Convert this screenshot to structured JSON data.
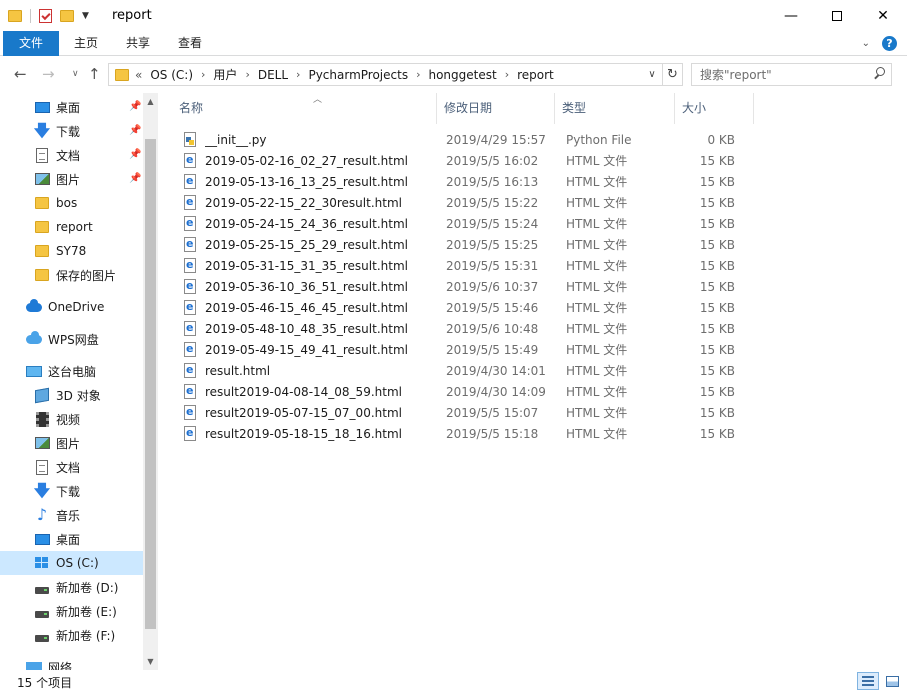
{
  "window": {
    "title": "report",
    "minimize_glyph": "—",
    "close_glyph": "✕"
  },
  "ribbon": {
    "tabs": [
      "文件",
      "主页",
      "共享",
      "查看"
    ]
  },
  "address": {
    "lead": "«",
    "crumbs": [
      "OS (C:)",
      "用户",
      "DELL",
      "PycharmProjects",
      "honggetest",
      "report"
    ],
    "search_placeholder": "搜索\"report\""
  },
  "nav": {
    "items": [
      {
        "label": "桌面",
        "icon": "desktop-icon",
        "pinned": true
      },
      {
        "label": "下载",
        "icon": "download-icon",
        "pinned": true
      },
      {
        "label": "文档",
        "icon": "document-icon",
        "pinned": true
      },
      {
        "label": "图片",
        "icon": "pictures-icon",
        "pinned": true
      },
      {
        "label": "bos",
        "icon": "folder-icon",
        "pinned": false
      },
      {
        "label": "report",
        "icon": "folder-icon",
        "pinned": false
      },
      {
        "label": "SY78",
        "icon": "folder-icon",
        "pinned": false
      },
      {
        "label": "保存的图片",
        "icon": "folder-icon",
        "pinned": false
      },
      {
        "label": "OneDrive",
        "icon": "onedrive-icon",
        "pinned": false
      },
      {
        "label": "WPS网盘",
        "icon": "wps-cloud-icon",
        "pinned": false
      },
      {
        "label": "这台电脑",
        "icon": "this-pc-icon",
        "pinned": false
      },
      {
        "label": "3D 对象",
        "icon": "3d-objects-icon",
        "pinned": false
      },
      {
        "label": "视频",
        "icon": "video-icon",
        "pinned": false
      },
      {
        "label": "图片",
        "icon": "pictures-icon",
        "pinned": false
      },
      {
        "label": "文档",
        "icon": "document-icon",
        "pinned": false
      },
      {
        "label": "下载",
        "icon": "download-icon",
        "pinned": false
      },
      {
        "label": "音乐",
        "icon": "music-icon",
        "pinned": false
      },
      {
        "label": "桌面",
        "icon": "desktop-icon",
        "pinned": false
      },
      {
        "label": "OS (C:)",
        "icon": "os-drive-icon",
        "pinned": false,
        "selected": true
      },
      {
        "label": "新加卷 (D:)",
        "icon": "drive-icon",
        "pinned": false
      },
      {
        "label": "新加卷 (E:)",
        "icon": "drive-icon",
        "pinned": false
      },
      {
        "label": "新加卷 (F:)",
        "icon": "drive-icon",
        "pinned": false
      },
      {
        "label": "网络",
        "icon": "network-icon",
        "pinned": false
      }
    ]
  },
  "columns": [
    "名称",
    "修改日期",
    "类型",
    "大小"
  ],
  "files": [
    {
      "name": "__init__.py",
      "date": "2019/4/29 15:57",
      "type": "Python File",
      "size": "0 KB",
      "icon": "python-file-icon"
    },
    {
      "name": "2019-05-02-16_02_27_result.html",
      "date": "2019/5/5 16:02",
      "type": "HTML 文件",
      "size": "15 KB",
      "icon": "html-file-icon"
    },
    {
      "name": "2019-05-13-16_13_25_result.html",
      "date": "2019/5/5 16:13",
      "type": "HTML 文件",
      "size": "15 KB",
      "icon": "html-file-icon"
    },
    {
      "name": "2019-05-22-15_22_30result.html",
      "date": "2019/5/5 15:22",
      "type": "HTML 文件",
      "size": "15 KB",
      "icon": "html-file-icon"
    },
    {
      "name": "2019-05-24-15_24_36_result.html",
      "date": "2019/5/5 15:24",
      "type": "HTML 文件",
      "size": "15 KB",
      "icon": "html-file-icon"
    },
    {
      "name": "2019-05-25-15_25_29_result.html",
      "date": "2019/5/5 15:25",
      "type": "HTML 文件",
      "size": "15 KB",
      "icon": "html-file-icon"
    },
    {
      "name": "2019-05-31-15_31_35_result.html",
      "date": "2019/5/5 15:31",
      "type": "HTML 文件",
      "size": "15 KB",
      "icon": "html-file-icon"
    },
    {
      "name": "2019-05-36-10_36_51_result.html",
      "date": "2019/5/6 10:37",
      "type": "HTML 文件",
      "size": "15 KB",
      "icon": "html-file-icon"
    },
    {
      "name": "2019-05-46-15_46_45_result.html",
      "date": "2019/5/5 15:46",
      "type": "HTML 文件",
      "size": "15 KB",
      "icon": "html-file-icon"
    },
    {
      "name": "2019-05-48-10_48_35_result.html",
      "date": "2019/5/6 10:48",
      "type": "HTML 文件",
      "size": "15 KB",
      "icon": "html-file-icon"
    },
    {
      "name": "2019-05-49-15_49_41_result.html",
      "date": "2019/5/5 15:49",
      "type": "HTML 文件",
      "size": "15 KB",
      "icon": "html-file-icon"
    },
    {
      "name": "result.html",
      "date": "2019/4/30 14:01",
      "type": "HTML 文件",
      "size": "15 KB",
      "icon": "html-file-icon"
    },
    {
      "name": "result2019-04-08-14_08_59.html",
      "date": "2019/4/30 14:09",
      "type": "HTML 文件",
      "size": "15 KB",
      "icon": "html-file-icon"
    },
    {
      "name": "result2019-05-07-15_07_00.html",
      "date": "2019/5/5 15:07",
      "type": "HTML 文件",
      "size": "15 KB",
      "icon": "html-file-icon"
    },
    {
      "name": "result2019-05-18-15_18_16.html",
      "date": "2019/5/5 15:18",
      "type": "HTML 文件",
      "size": "15 KB",
      "icon": "html-file-icon"
    }
  ],
  "status": {
    "count_text": "15 个项目"
  },
  "colors": {
    "accent": "#1979ca",
    "selection": "#cce8ff",
    "header_text": "#4c607a"
  }
}
